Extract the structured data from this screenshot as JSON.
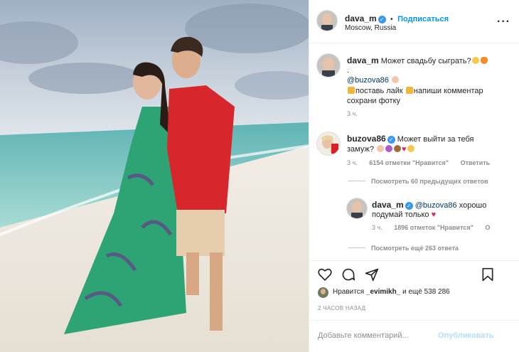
{
  "post": {
    "author": "dava_m",
    "follow_label": "Подписаться",
    "location": "Moscow, Russia",
    "more_icon": "more-options-icon"
  },
  "caption": {
    "username": "dava_m",
    "text": "Может свадьбу сыграть?",
    "dot": ".",
    "mention": "@buzova86",
    "line2_a": "поставь лайк",
    "line2_b": "напиши комментар",
    "line3": "сохрани фотку",
    "time": "3 ч."
  },
  "comment": {
    "username": "buzova86",
    "text_line1": "Может выйти за тебя",
    "text_line2": "замуж?",
    "time": "3 ч.",
    "likes": "6154 отметки \"Нравится\"",
    "reply_label": "Ответить",
    "view_previous": "Посмотреть 60 предыдущих ответов"
  },
  "reply": {
    "username": "dava_m",
    "mention": "@buzova86",
    "text_line1": "хорошо",
    "text_line2": "подумай только",
    "time": "3 ч.",
    "likes": "1896 отметок \"Нравится\"",
    "reply_label": "О",
    "view_more": "Посмотреть ещё 263 ответа"
  },
  "actions": {
    "like_icon": "heart-icon",
    "comment_icon": "comment-icon",
    "share_icon": "share-icon",
    "save_icon": "bookmark-icon"
  },
  "likes": {
    "prefix": "Нравится",
    "user": "_evimikh_",
    "suffix": "и ещё 538 286"
  },
  "time_ago": "2 ЧАСОВ НАЗАД",
  "add_comment": {
    "placeholder": "Добавьте комментарий...",
    "publish_label": "Опубликовать"
  },
  "colors": {
    "accent": "#0095f6",
    "verified": "#3897f0",
    "heart": "#e0245e"
  }
}
